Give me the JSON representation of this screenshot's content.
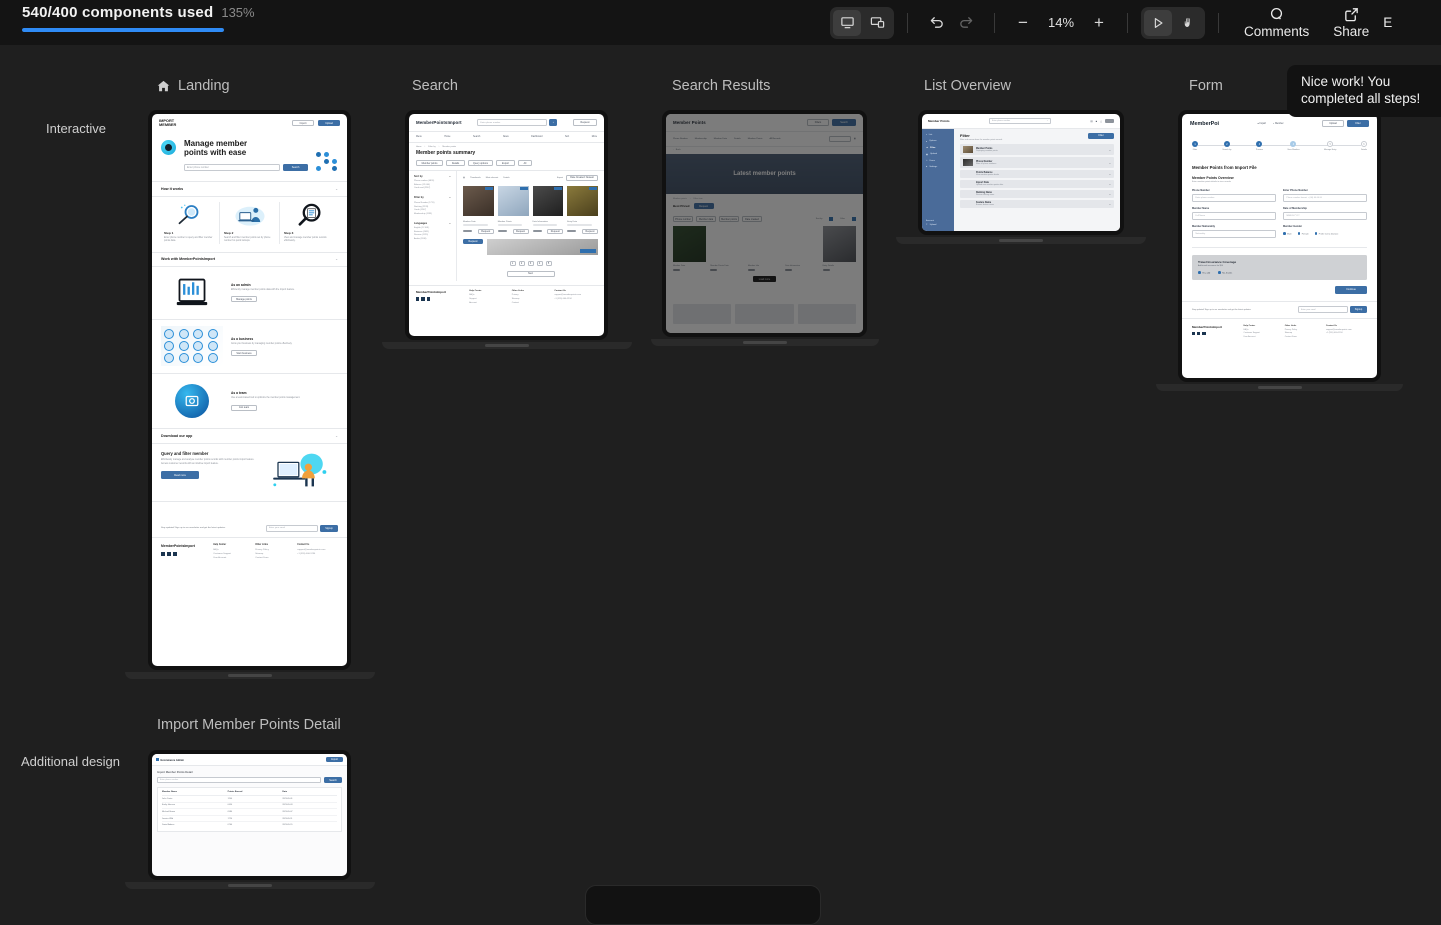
{
  "topbar": {
    "usage_count": "540/400 components used",
    "usage_percent": "135%",
    "usage_fill_width": "100%",
    "accent_color": "#2f8bf5",
    "device_desktop_icon": "desktop-icon",
    "device_responsive_icon": "responsive-icon",
    "undo_icon": "undo-icon",
    "redo_icon": "redo-icon",
    "zoom_out_label": "−",
    "zoom_level": "14%",
    "zoom_in_label": "+",
    "play_icon": "play-icon",
    "hand_icon": "hand-icon",
    "comments_label": "Comments",
    "share_label": "Share",
    "cut_off_label": "E"
  },
  "tooltip": {
    "text": "Nice work! You completed all steps!"
  },
  "rows": [
    {
      "label": "Interactive"
    },
    {
      "label": "Additional design"
    }
  ],
  "frames": [
    {
      "title": "Landing",
      "icon": "home-icon"
    },
    {
      "title": "Search",
      "icon": ""
    },
    {
      "title": "Search Results",
      "icon": ""
    },
    {
      "title": "List Overview",
      "icon": ""
    },
    {
      "title": "Form",
      "icon": ""
    },
    {
      "title": "Import Member Points Detail",
      "icon": ""
    }
  ],
  "landing": {
    "brand_line1": "IMPORT",
    "brand_line2": "MEMBER",
    "nav_import": "Import",
    "nav_upload": "Upload",
    "hero_heading_l1": "Manage member",
    "hero_heading_l2": "points with ease",
    "hero_input_placeholder": "Enter phone number",
    "hero_button": "Search",
    "section_how": "How it works",
    "steps": [
      {
        "title": "Step 1",
        "desc": "Enter phone number to query and filter member points data."
      },
      {
        "title": "Step 2",
        "desc": "Search and filter member points set by phone number for quick lookups."
      },
      {
        "title": "Step 3",
        "desc": "View and manage member points records effortlessly."
      }
    ],
    "section_work": "Work with MemberPointsImport",
    "cards": [
      {
        "title": "As an admin",
        "desc": "Efficiently manage member points data with the import feature.",
        "button": "Manage points"
      },
      {
        "title": "As a business",
        "desc": "Grow your business by managing member points effectively.",
        "button": "Start business"
      },
      {
        "title": "As a team",
        "desc": "Use a team-based tool to optimize the member points management.",
        "button": "Join team"
      }
    ],
    "section_download": "Download our app",
    "promo_title": "Query and filter member",
    "promo_desc": "Effortlessly manage and analyse member points records with member points import feature. Access customer records with an intuitive import feature.",
    "promo_button": "Read more",
    "newsletter_text": "Stay updated! Sign up to our newsletter and get the latest updates.",
    "newsletter_placeholder": "Enter your email",
    "newsletter_button": "Signup",
    "footer_brand": "MemberPointsImport",
    "footer_cols": [
      {
        "head": "Help Center",
        "links": [
          "FAQs",
          "Customer Support",
          "User Account"
        ]
      },
      {
        "head": "Other Links",
        "links": [
          "Privacy Policy",
          "Sitemap",
          "Contact Form"
        ]
      },
      {
        "head": "Contact Us",
        "links": [
          "support@memberpoints.com",
          "+1 (555) 000-1234"
        ]
      }
    ],
    "social_icons": [
      "linkedin-icon",
      "twitter-icon",
      "instagram-icon"
    ]
  },
  "search": {
    "brand": "MemberPointsImport",
    "search_placeholder": "Enter phone number",
    "search_button_icon": "search-icon",
    "header_button": "Request",
    "nav_items": [
      "Menu",
      "Home",
      "Search",
      "News",
      "Dashboard",
      "Sort",
      "More"
    ],
    "breadcrumb": [
      "Home",
      "Filter by",
      "Member points"
    ],
    "title": "Member points summary",
    "chips": [
      "Member points",
      "Details",
      "Query options",
      "Export",
      "All"
    ],
    "facets": [
      {
        "head": "Sort by",
        "options": [
          "Phone number (4891)",
          "Balance (12 000)",
          "Cards and (2267)"
        ]
      },
      {
        "head": "Filter by",
        "options": [
          "Phone Number (1711)",
          "Ranking (2233)",
          "Cards    (1247)",
          "Membership (1139)"
        ]
      },
      {
        "head": "Languages",
        "options": [
          "English (12 001)",
          "Business (2451)",
          "Russian (1129)",
          "Arabic (1186)"
        ]
      }
    ],
    "toolbar_links": [
      "Thumbnails",
      "Most relevant",
      "Details",
      "Export"
    ],
    "sort_select": "Date Created: Newest",
    "result_labels": [
      "Member Data",
      "Member Points",
      "Date Information",
      "Entry Date"
    ],
    "result_button": "Request",
    "pagination": [
      "1",
      "2",
      "3",
      "4",
      "5"
    ],
    "bottom_button": "Next",
    "footer_brand": "MemberPointsImport",
    "footer_cols": [
      {
        "head": "Help Center",
        "links": [
          "FAQs",
          "Support",
          "Account"
        ]
      },
      {
        "head": "Other Links",
        "links": [
          "Privacy",
          "Sitemap",
          "Contact"
        ]
      },
      {
        "head": "Contact Us",
        "links": [
          "support@memberpoints.com",
          "+1 (555) 000-1234"
        ]
      }
    ]
  },
  "search_results": {
    "brand": "Member Points",
    "header_buttons": [
      "Filters",
      "Search"
    ],
    "nav_items": [
      "Phone Number",
      "Membership",
      "Member Data",
      "Details",
      "Member Points",
      "All Records"
    ],
    "back_link": "Back",
    "hero_title": "Latest member points",
    "breadcrumb": [
      "Member points",
      "Filter item"
    ],
    "subtitle": "Best Priced",
    "subtitle_button": "Request",
    "chips": [
      "Phone number",
      "Member data",
      "Member points",
      "Date created"
    ],
    "sort_label": "Sort by",
    "filter_label": "Filter",
    "card_price_labels": [
      "Member Data",
      "Member Points Data",
      "Member Info",
      "Date Information",
      "Entry Details"
    ],
    "load_more": "Load more"
  },
  "list_overview": {
    "brand": "Member Points",
    "search_placeholder": "Enter phone number",
    "sidebar_items": [
      "List",
      "Options",
      "Filter",
      "Upload",
      "Users",
      "Settings"
    ],
    "sidebar_footer_head": "Account",
    "sidebar_footer_item": "Upload",
    "title": "Filter",
    "subtitle": "Filter and narrow down the member points records",
    "primary_button": "Filter",
    "rows": [
      {
        "title": "Member Points",
        "desc": "Displaying member points",
        "has_thumb": true
      },
      {
        "title": "Phone Number",
        "desc": "Filter all phone numbers",
        "has_thumb": true
      },
      {
        "title": "Points Balance",
        "desc": "View member points details",
        "has_thumb": false
      },
      {
        "title": "Import Data",
        "desc": "Upload new member points data",
        "has_thumb": false
      },
      {
        "title": "Ranking Name",
        "desc": "Review ranking views",
        "has_thumb": false
      },
      {
        "title": "Feature Name",
        "desc": "Browse feature views",
        "has_thumb": false
      }
    ]
  },
  "form": {
    "brand": "MemberPoi",
    "nav_import": "Import",
    "nav_member": "Member",
    "btn_upload": "Upload",
    "btn_filter": "Filter",
    "steps": [
      {
        "num": "1",
        "label": "Filter",
        "state": "done"
      },
      {
        "num": "2",
        "label": "Search by",
        "state": "done"
      },
      {
        "num": "3",
        "label": "Preview",
        "state": "done"
      },
      {
        "num": "4",
        "label": "View Member",
        "state": "current"
      },
      {
        "num": "5",
        "label": "Manage Entry",
        "state": "todo"
      },
      {
        "num": "6",
        "label": "Details",
        "state": "todo"
      }
    ],
    "page_title": "Member Points from Import File",
    "section_title": "Member Points Overview",
    "section_sub": "Enter member points details to view records",
    "fields": [
      {
        "label": "Phone Number",
        "placeholder": "Enter phone number"
      },
      {
        "label": "Enter Phone Number",
        "placeholder": "Phone number format: + (00) 00 00 00"
      },
      {
        "label": "Member Name",
        "placeholder": "Full Name"
      },
      {
        "label": "Date of Membership",
        "placeholder": "MM/DD/YYYY"
      },
      {
        "label": "Member Nationality",
        "placeholder": "Nationality"
      }
    ],
    "gender_label": "Member Gender",
    "gender_options": [
      "Male",
      "Female",
      "Prefer not to disclose"
    ],
    "panel_title": "Travel Insurance Coverage",
    "panel_sub": "Add travel insurance for $50",
    "panel_options": [
      "Yes, add",
      "No, thanks"
    ],
    "continue_button": "Continue",
    "newsletter_text": "Stay updated! Sign up to our newsletter and get the latest updates.",
    "newsletter_placeholder": "Enter your email",
    "newsletter_button": "Signup",
    "footer_brand": "MemberPointsImport",
    "footer_cols": [
      {
        "head": "Help Center",
        "links": [
          "FAQs",
          "Customer Support",
          "User Account"
        ]
      },
      {
        "head": "Other Links",
        "links": [
          "Privacy Policy",
          "Sitemap",
          "Contact Form"
        ]
      },
      {
        "head": "Contact Us",
        "links": [
          "support@memberpoints.com",
          "+1 (555) 000-1234"
        ]
      }
    ]
  },
  "detail": {
    "brand": "Ecommerce Admin",
    "header_button": "Import",
    "title": "Import Member Points Detail",
    "search_placeholder": "Enter phone number",
    "search_button": "Search",
    "columns": [
      "Member Name",
      "Points Earned",
      "Date"
    ],
    "rows": [
      [
        "John Carter",
        "1200",
        "2023-05-01"
      ],
      [
        "Emily Johnson",
        "0450",
        "2023-05-03"
      ],
      [
        "Michael Brown",
        "0980",
        "2023-05-07"
      ],
      [
        "Jessica Wild",
        "1720",
        "2023-05-11"
      ],
      [
        "Daniel Adams",
        "0760",
        "2023-05-15"
      ]
    ]
  }
}
